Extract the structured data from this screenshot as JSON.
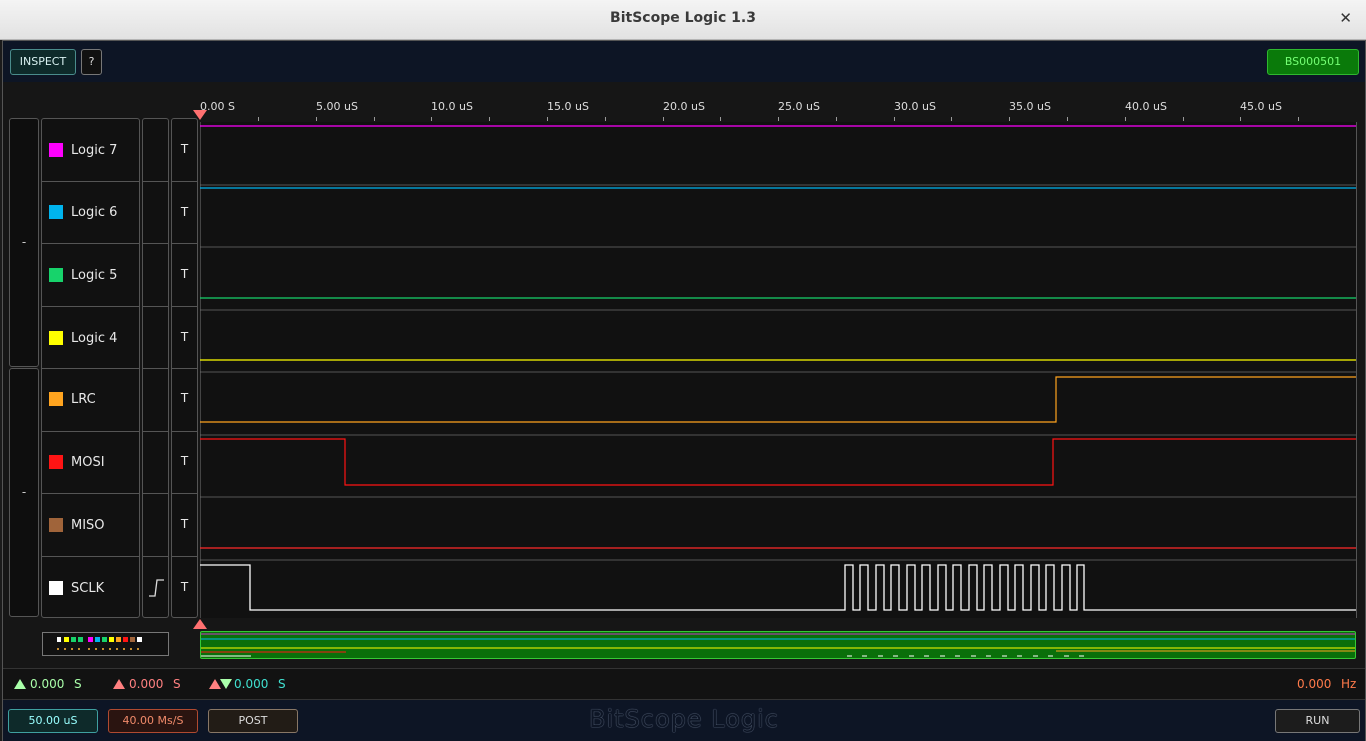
{
  "window": {
    "title": "BitScope Logic 1.3"
  },
  "toolbar": {
    "inspect_label": "INSPECT",
    "help_label": "?",
    "device_id": "BS000501"
  },
  "ruler": {
    "labels": [
      "0.00  S",
      "5.00 uS",
      "10.0 uS",
      "15.0 uS",
      "20.0 uS",
      "25.0 uS",
      "30.0 uS",
      "35.0 uS",
      "40.0 uS",
      "45.0 uS"
    ]
  },
  "groups": [
    {
      "label": "-"
    },
    {
      "label": "-"
    }
  ],
  "channels": [
    {
      "name": "Logic 7",
      "color": "#ff00ff",
      "trigger_label": "T"
    },
    {
      "name": "Logic 6",
      "color": "#00b4ee",
      "trigger_label": "T"
    },
    {
      "name": "Logic 5",
      "color": "#17d36b",
      "trigger_label": "T"
    },
    {
      "name": "Logic 4",
      "color": "#ffff00",
      "trigger_label": "T"
    },
    {
      "name": "LRC",
      "color": "#ffa41f",
      "trigger_label": "T"
    },
    {
      "name": "MOSI",
      "color": "#ff1414",
      "trigger_label": "T"
    },
    {
      "name": "MISO",
      "color": "#a0643a",
      "trigger_label": "T"
    },
    {
      "name": "SCLK",
      "color": "#ffffff",
      "trigger_label": "T",
      "trigger_edge": "rising-edge-icon"
    }
  ],
  "status": {
    "cursor1": {
      "value": "0.000",
      "unit": "S",
      "color": "#aaffaa"
    },
    "cursor2": {
      "value": "0.000",
      "unit": "S",
      "color": "#ff8080"
    },
    "delta": {
      "value": "0.000",
      "unit": "S",
      "color": "#40e0d0"
    },
    "frequency": {
      "value": "0.000",
      "unit": "Hz",
      "color": "#ff7a4a"
    }
  },
  "bottom": {
    "timebase": "50.00 uS",
    "sample_rate": "40.00 Ms/S",
    "post_label": "POST",
    "brand": "BitScope Logic",
    "run_label": "RUN"
  }
}
